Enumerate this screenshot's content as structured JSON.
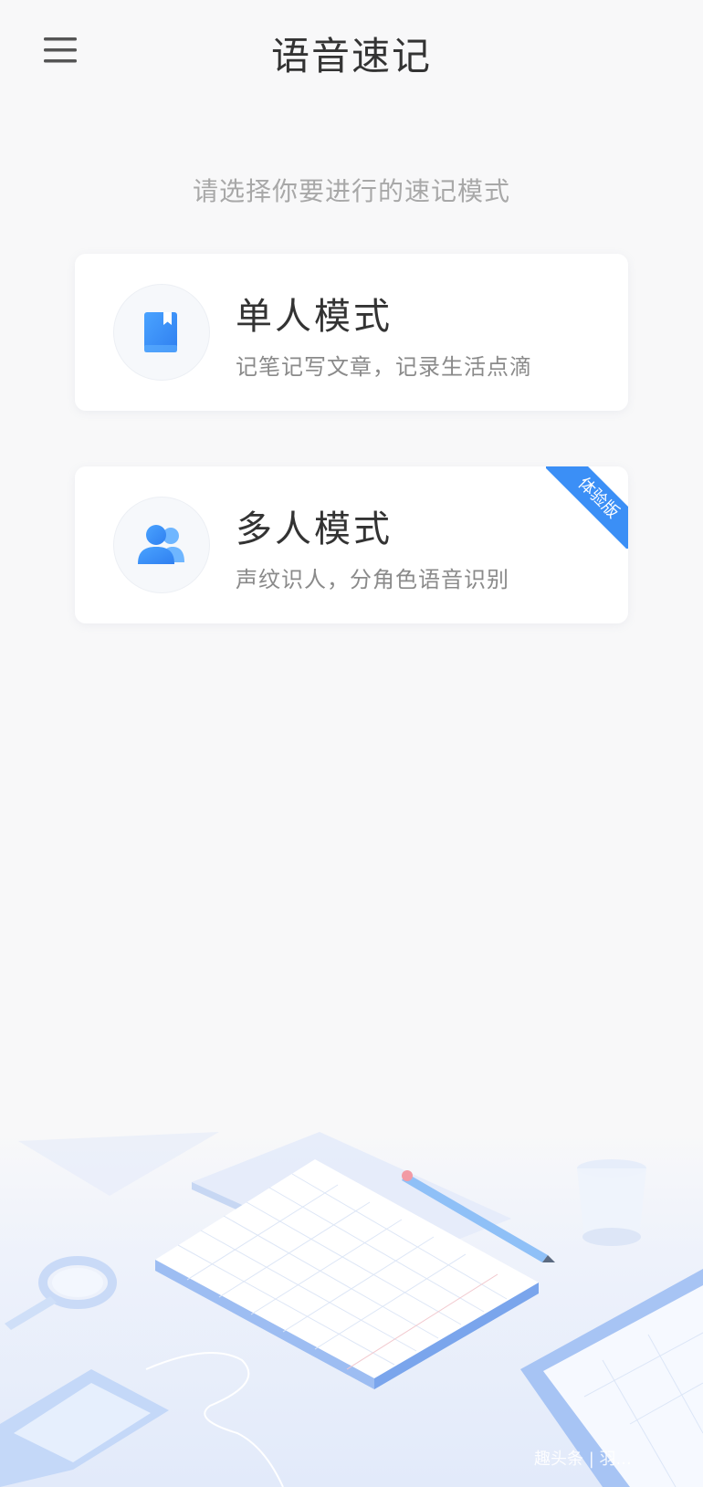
{
  "header": {
    "title": "语音速记"
  },
  "prompt": "请选择你要进行的速记模式",
  "modes": [
    {
      "title": "单人模式",
      "desc": "记笔记写文章，记录生活点滴",
      "icon": "bookmark-icon"
    },
    {
      "title": "多人模式",
      "desc": "声纹识人，分角色语音识别",
      "icon": "users-icon",
      "badge": "体验版"
    }
  ],
  "colors": {
    "accent": "#3b8ff6",
    "background": "#f8f8f9"
  },
  "watermark": "趣头条 | 羽..."
}
